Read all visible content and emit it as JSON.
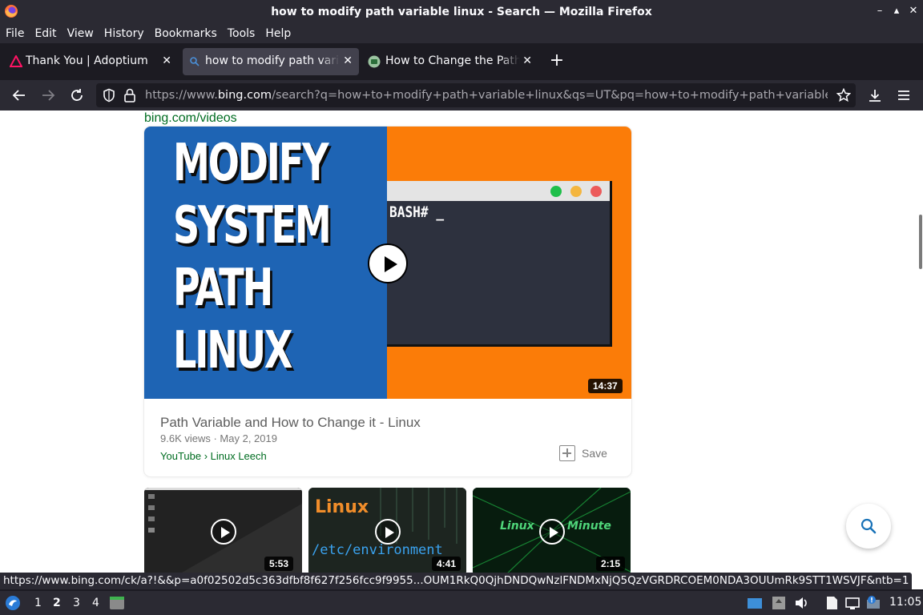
{
  "window": {
    "title": "how to modify path variable linux - Search — Mozilla Firefox",
    "minimize_glyph": "–",
    "maximize_glyph": "▴",
    "close_glyph": "✕"
  },
  "menu": [
    "File",
    "Edit",
    "View",
    "History",
    "Bookmarks",
    "Tools",
    "Help"
  ],
  "tabs": [
    {
      "label": "Thank You | Adoptium",
      "icon": "adoptium-icon",
      "active": false
    },
    {
      "label": "how to modify path variable linux",
      "icon": "bing-icon",
      "active": true
    },
    {
      "label": "How to Change the Path Variable",
      "icon": "youtube-style-icon",
      "active": false
    }
  ],
  "tab_close_glyph": "✕",
  "new_tab_glyph": "+",
  "nav": {
    "url_prefix": "https://www.",
    "url_domain": "bing.com",
    "url_rest": "/search?q=how+to+modify+path+variable+linux&qs=UT&pq=how+to+modify+path+variable&sk"
  },
  "page": {
    "source_link": "bing.com/videos",
    "featured_video": {
      "thumbnail_text": [
        "MODIFY",
        "SYSTEM",
        "PATH",
        "LINUX"
      ],
      "terminal_prompt": "BASH# _",
      "duration": "14:37",
      "title": "Path Variable and How to Change it - Linux",
      "meta": "9.6K views · May 2, 2019",
      "source": "YouTube › Linux Leech",
      "save_label": "Save"
    },
    "more_videos": [
      {
        "duration": "5:53",
        "thumb_text": ""
      },
      {
        "duration": "4:41",
        "thumb_text": "Linux",
        "thumb_subtext": "/etc/environment"
      },
      {
        "duration": "2:15",
        "thumb_text": "Linux",
        "thumb_subtext": "Minute"
      }
    ]
  },
  "status_url": "https://www.bing.com/ck/a?!&&p=a0f02502d5c363dfbf8f627f256fcc9f9955...OUM1RkQ0QjhDNDQwNzlFNDMxNjQ5QzVGRDRCOEM0NDA3OUUmRk9STT1WSVJF&ntb=1",
  "taskbar": {
    "workspaces": [
      "1",
      "2",
      "3",
      "4"
    ],
    "active_workspace": "2",
    "clock": "11:05"
  },
  "colors": {
    "chrome_bg": "#2b2a33",
    "tabstrip_bg": "#1c1b22",
    "link_green": "#006d21",
    "thumb_blue": "#1e64b4",
    "thumb_orange": "#fb7c08"
  }
}
